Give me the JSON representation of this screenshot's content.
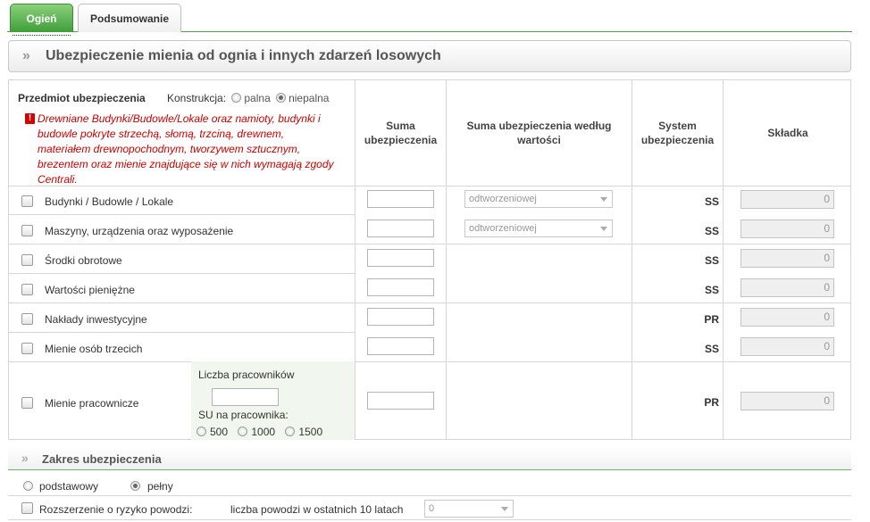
{
  "tabs": [
    {
      "label": "Ogień",
      "active": true
    },
    {
      "label": "Podsumowanie",
      "active": false
    }
  ],
  "section_title": "Ubezpieczenie mienia od ognia i innych zdarzeń losowych",
  "table": {
    "subject_header": "Przedmiot ubezpieczenia",
    "construction_label": "Konstrukcja:",
    "construction_options": [
      "palna",
      "niepalna"
    ],
    "construction_selected": "niepalna",
    "warning": "Drewniane Budynki/Budowle/Lokale oraz namioty, budynki i budowle pokryte strzechą, słomą, trzciną, drewnem, materiałem drewnopochodnym, tworzywem sztucznym, brezentem oraz mienie znajdujące się w nich wymagają zgody Centrali.",
    "headers": {
      "sum": "Suma ubezpieczenia",
      "sum_by_value": "Suma ubezpieczenia według wartości",
      "system": "System ubezpieczenia",
      "premium": "Składka"
    },
    "rows": [
      {
        "label": "Budynki / Budowle / Lokale",
        "value_basis": "odtworzeniowej",
        "system": "SS",
        "premium": "0"
      },
      {
        "label": "Maszyny, urządzenia oraz wyposażenie",
        "value_basis": "odtworzeniowej",
        "system": "SS",
        "premium": "0"
      },
      {
        "label": "Środki obrotowe",
        "system": "SS",
        "premium": "0"
      },
      {
        "label": "Wartości pieniężne",
        "system": "SS",
        "premium": "0"
      },
      {
        "label": "Nakłady inwestycyjne",
        "system": "PR",
        "premium": "0"
      },
      {
        "label": "Mienie osób trzecich",
        "system": "SS",
        "premium": "0"
      },
      {
        "label": "Mienie pracownicze",
        "system": "PR",
        "premium": "0"
      }
    ],
    "employees": {
      "count_label": "Liczba pracowników",
      "su_label": "SU na pracownika:",
      "su_options": [
        "500",
        "1000",
        "1500"
      ]
    }
  },
  "scope": {
    "title": "Zakres ubezpieczenia",
    "options": [
      "podstawowy",
      "pełny"
    ],
    "selected": "pełny",
    "flood_label": "Rozszerzenie o ryzyko powodzi:",
    "flood_count_label": "liczba powodzi w ostatnich 10 latach",
    "flood_count_value": "0"
  }
}
